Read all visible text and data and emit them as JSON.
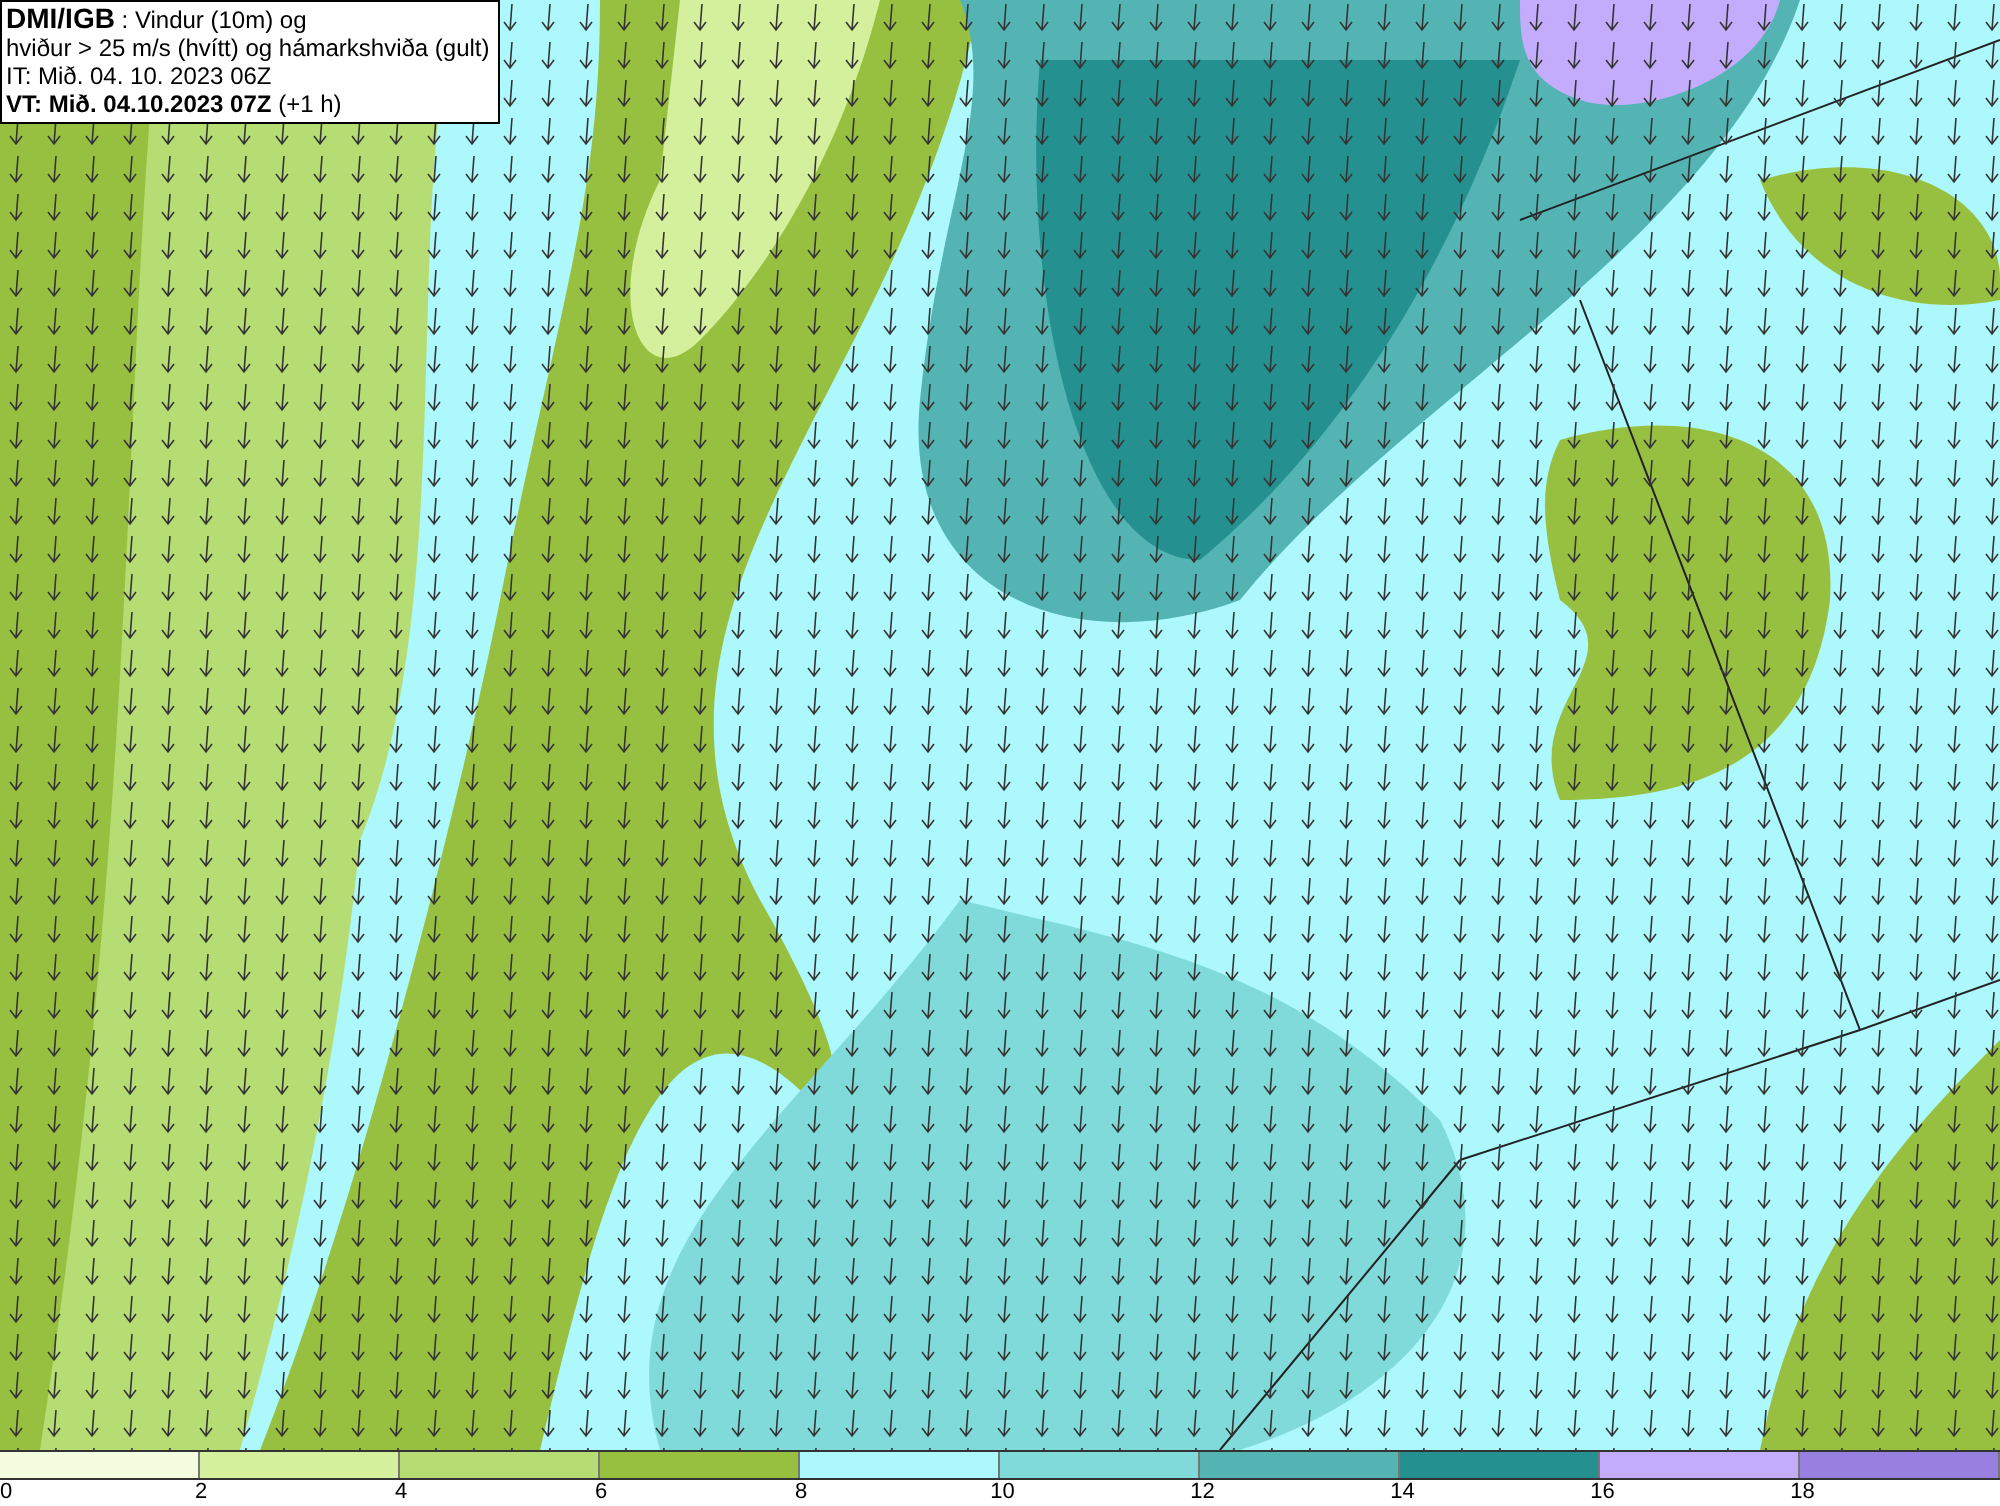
{
  "info_box": {
    "lines": [
      "**DMI/IGB** : Vindur (10m) og",
      "hviður > 25 m/s (hvítt) og hámarkshviða (gult)",
      "IT: Mið. 04. 10. 2023 06Z",
      "**VT: Mið. 04.10.2023 07Z** (+1 h)"
    ]
  },
  "legend": {
    "bins": [
      {
        "color": "#f4fde0",
        "label": "0"
      },
      {
        "color": "#d4f09c",
        "label": "2"
      },
      {
        "color": "#b6dc74",
        "label": "4"
      },
      {
        "color": "#98c040",
        "label": "6"
      },
      {
        "color": "#acf8fc",
        "label": "8"
      },
      {
        "color": "#80dada",
        "label": "10"
      },
      {
        "color": "#54b4b4",
        "label": "12"
      },
      {
        "color": "#249090",
        "label": "14"
      },
      {
        "color": "#c4acfc",
        "label": "16"
      },
      {
        "color": "#9880e0",
        "label": "18"
      }
    ]
  }
}
